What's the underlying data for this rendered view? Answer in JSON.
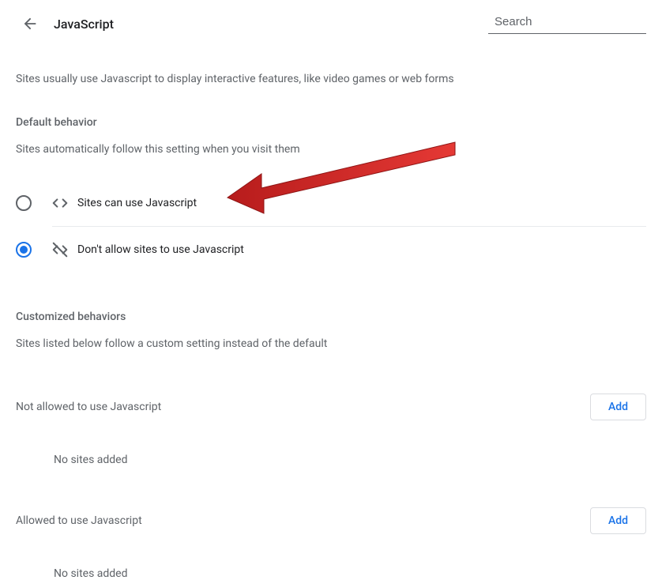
{
  "header": {
    "title": "JavaScript",
    "search_placeholder": "Search"
  },
  "intro": "Sites usually use Javascript to display interactive features, like video games or web forms",
  "default_behavior": {
    "title": "Default behavior",
    "subtitle": "Sites automatically follow this setting when you visit them",
    "options": [
      {
        "label": "Sites can use Javascript",
        "selected": false
      },
      {
        "label": "Don't allow sites to use Javascript",
        "selected": true
      }
    ]
  },
  "customized": {
    "title": "Customized behaviors",
    "subtitle": "Sites listed below follow a custom setting instead of the default"
  },
  "not_allowed": {
    "title": "Not allowed to use Javascript",
    "add_label": "Add",
    "empty": "No sites added"
  },
  "allowed": {
    "title": "Allowed to use Javascript",
    "add_label": "Add",
    "empty": "No sites added"
  }
}
